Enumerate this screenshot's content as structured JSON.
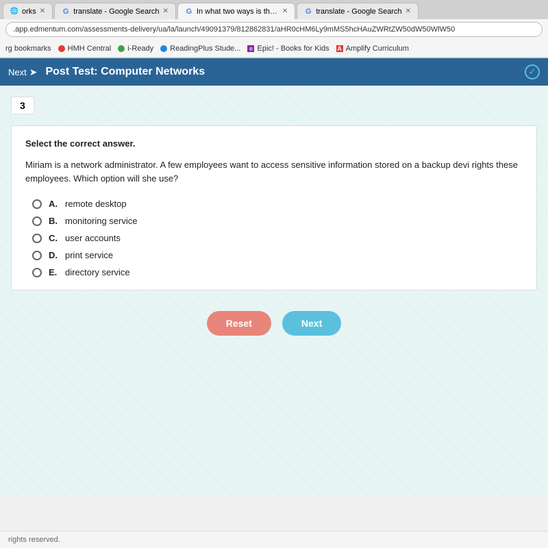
{
  "tabs": [
    {
      "id": "tab1",
      "label": "orks",
      "favicon": "🌐",
      "active": false
    },
    {
      "id": "tab2",
      "label": "translate - Google Search",
      "favicon": "G",
      "active": false
    },
    {
      "id": "tab3",
      "label": "In what two ways is the plain te...",
      "favicon": "G",
      "active": true
    },
    {
      "id": "tab4",
      "label": "translate - Google Search",
      "favicon": "G",
      "active": false
    }
  ],
  "address_bar": ".app.edmentum.com/assessments-delivery/ua/la/launch/49091379/812862831/aHR0cHM6Ly9mMS5hcHAuZWRtZW50dW50WlW50",
  "bookmarks": [
    {
      "label": "rg bookmarks",
      "color": null
    },
    {
      "label": "HMH Central",
      "color": "#e53935"
    },
    {
      "label": "i-Ready",
      "color": "#43a047"
    },
    {
      "label": "ReadingPlus Stude...",
      "color": "#1e88e5"
    },
    {
      "label": "Epic! - Books for Kids",
      "color": "#8e24aa"
    },
    {
      "label": "Amplify Curriculum",
      "color": "#e53935"
    }
  ],
  "header": {
    "next_label": "Next",
    "title": "Post Test: Computer Networks"
  },
  "question": {
    "number": "3",
    "instruction": "Select the correct answer.",
    "text": "Miriam is a network administrator. A few employees want to access sensitive information stored on a backup devi rights these employees. Which option will she use?",
    "options": [
      {
        "letter": "A.",
        "text": "remote desktop"
      },
      {
        "letter": "B.",
        "text": "monitoring service"
      },
      {
        "letter": "C.",
        "text": "user accounts"
      },
      {
        "letter": "D.",
        "text": "print service"
      },
      {
        "letter": "E.",
        "text": "directory service"
      }
    ]
  },
  "buttons": {
    "reset_label": "Reset",
    "next_label": "Next"
  },
  "footer": {
    "text": "rights reserved."
  }
}
